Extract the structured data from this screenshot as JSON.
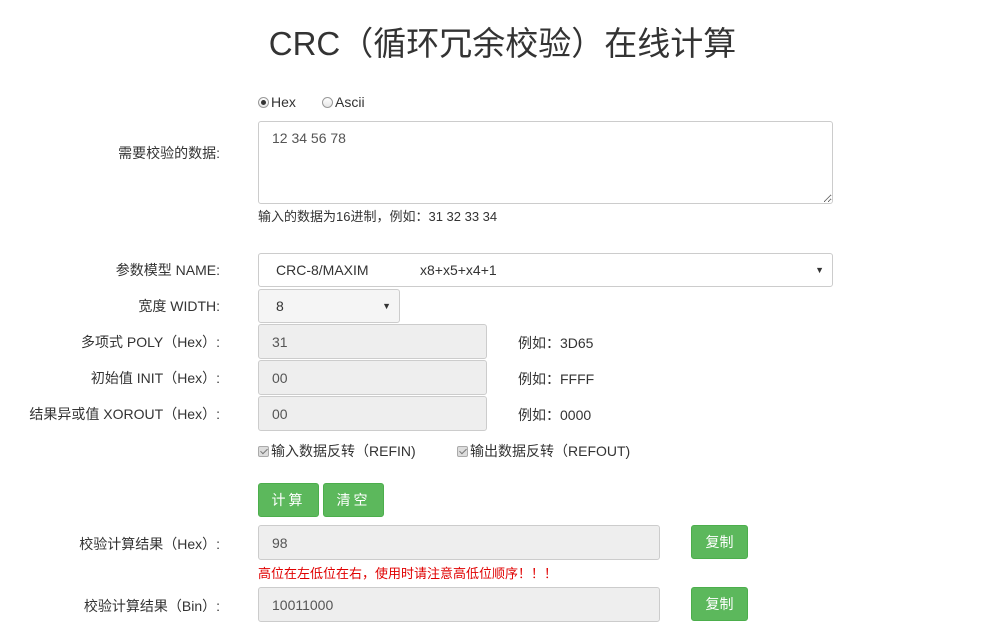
{
  "title": "CRC（循环冗余校验）在线计算",
  "input_format": {
    "options": [
      "Hex",
      "Ascii"
    ],
    "selected": "Hex"
  },
  "data_label": "需要校验的数据:",
  "data_value": "12 34 56 78",
  "data_hint": "输入的数据为16进制，例如：31 32 33 34",
  "model_label": "参数模型 NAME:",
  "model_value": "CRC-8/MAXIM",
  "model_poly_text": "x8+x5+x4+1",
  "width_label": "宽度 WIDTH:",
  "width_value": "8",
  "poly_label": "多项式 POLY（Hex）:",
  "poly_value": "31",
  "poly_example": "例如：3D65",
  "init_label": "初始值 INIT（Hex）:",
  "init_value": "00",
  "init_example": "例如：FFFF",
  "xorout_label": "结果异或值 XOROUT（Hex）:",
  "xorout_value": "00",
  "xorout_example": "例如：0000",
  "refin_label": "输入数据反转（REFIN)",
  "refin_checked": true,
  "refout_label": "输出数据反转（REFOUT)",
  "refout_checked": true,
  "calc_button": "计算",
  "clear_button": "清空",
  "result_hex_label": "校验计算结果（Hex）:",
  "result_hex_value": "98",
  "result_warning": "高位在左低位在右，使用时请注意高低位顺序！！！",
  "result_bin_label": "校验计算结果（Bin）:",
  "result_bin_value": "10011000",
  "copy_button": "复制",
  "colors": {
    "button_green": "#5cb85c",
    "warning_red": "#e00000"
  }
}
